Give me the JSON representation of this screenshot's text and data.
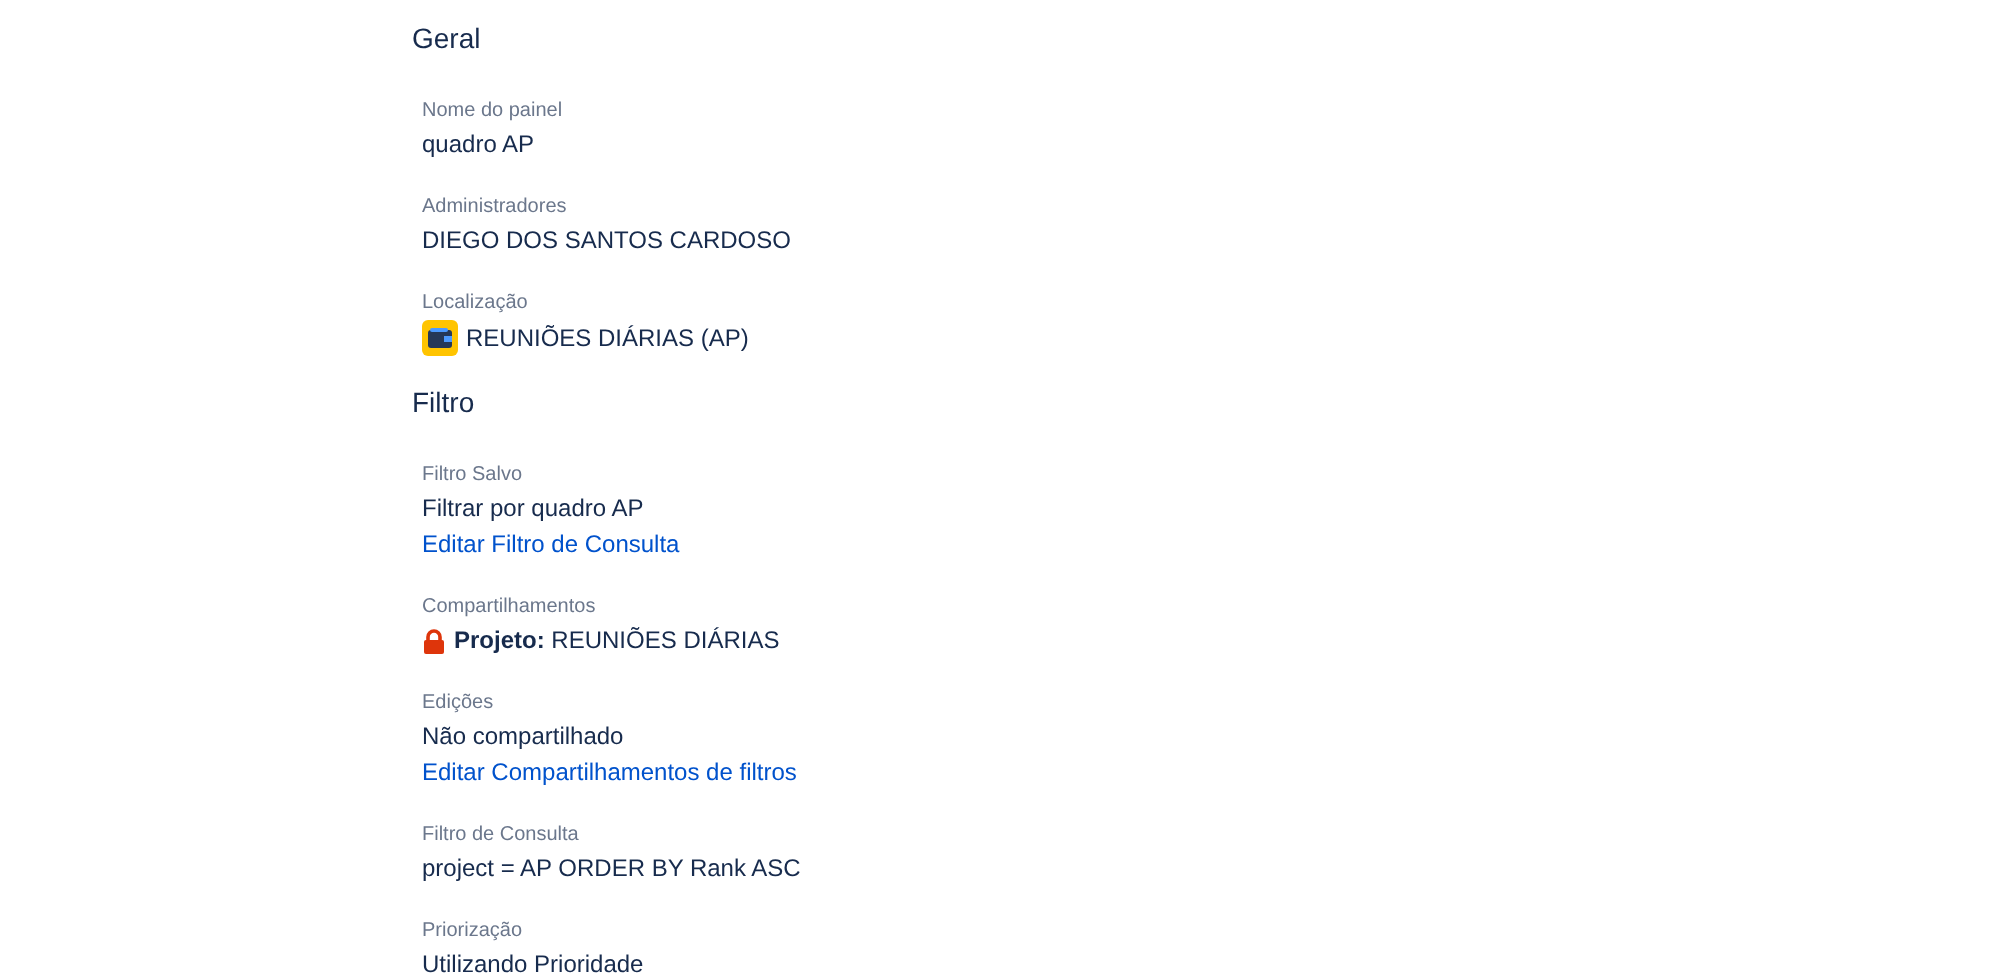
{
  "sections": [
    {
      "title": "Geral",
      "fields": [
        {
          "label": "Nome do painel",
          "lines": [
            {
              "kind": "text",
              "text": "quadro AP"
            }
          ]
        },
        {
          "label": "Administradores",
          "lines": [
            {
              "kind": "text",
              "text": "DIEGO DOS SANTOS CARDOSO"
            }
          ]
        },
        {
          "label": "Localização",
          "lines": [
            {
              "kind": "project",
              "text": "REUNIÕES DIÁRIAS (AP)"
            }
          ]
        }
      ]
    },
    {
      "title": "Filtro",
      "fields": [
        {
          "label": "Filtro Salvo",
          "lines": [
            {
              "kind": "text",
              "text": "Filtrar por quadro AP"
            },
            {
              "kind": "link",
              "text": "Editar Filtro de Consulta"
            }
          ]
        },
        {
          "label": "Compartilhamentos",
          "lines": [
            {
              "kind": "share",
              "text": "**Projeto:** REUNIÕES DIÁRIAS"
            }
          ]
        },
        {
          "label": "Edições",
          "lines": [
            {
              "kind": "text",
              "text": "Não compartilhado"
            },
            {
              "kind": "link",
              "text": "Editar Compartilhamentos de filtros"
            }
          ]
        },
        {
          "label": "Filtro de Consulta",
          "lines": [
            {
              "kind": "text",
              "text": "project = AP ORDER BY Rank ASC"
            }
          ]
        },
        {
          "label": "Priorização",
          "lines": [
            {
              "kind": "text",
              "text": "Utilizando Prioridade"
            }
          ]
        }
      ]
    }
  ]
}
